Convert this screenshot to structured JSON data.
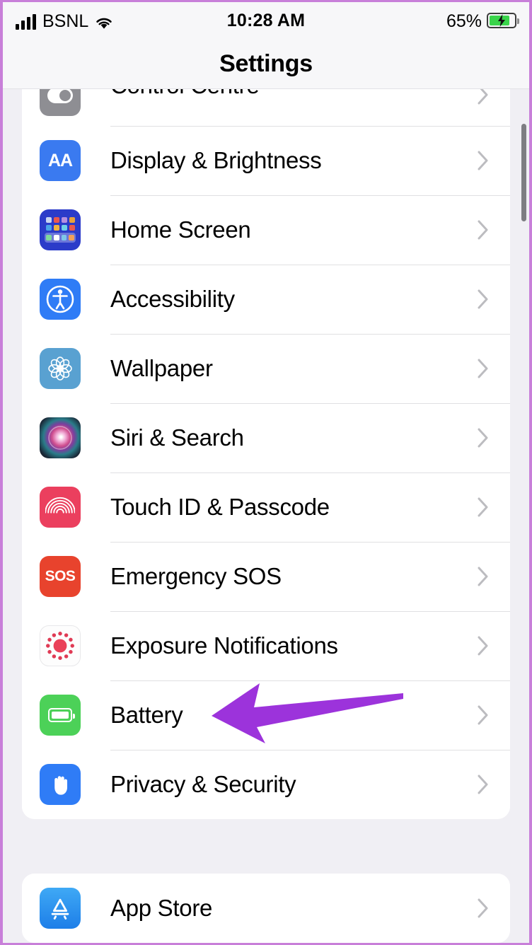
{
  "status_bar": {
    "carrier": "BSNL",
    "signal_icon": "cellular-bars-icon",
    "wifi_icon": "wifi-icon",
    "time": "10:28 AM",
    "battery_percent": "65%",
    "battery_icon": "battery-charging-icon",
    "battery_level": 65,
    "charging": true
  },
  "nav": {
    "title": "Settings"
  },
  "colors": {
    "page_background": "#f0eff4",
    "card_background": "#ffffff",
    "separator": "#e0e0e2",
    "chevron": "#bcbcc0",
    "arrow_annotation": "#9c33db",
    "frame_border": "#c87fd9",
    "battery_green": "#4cd158",
    "scrollbar": "#7d7d82"
  },
  "sections": [
    {
      "name": "settings-group-primary",
      "clipped_top": true,
      "rows": [
        {
          "label": "Control Centre",
          "icon": "control-centre-icon",
          "icon_style": "ic-cc",
          "partial": true,
          "chevron": true
        },
        {
          "label": "Display & Brightness",
          "icon": "display-brightness-icon",
          "icon_style": "ic-display",
          "partial": false,
          "chevron": true
        },
        {
          "label": "Home Screen",
          "icon": "home-screen-icon",
          "icon_style": "ic-home",
          "partial": false,
          "chevron": true
        },
        {
          "label": "Accessibility",
          "icon": "accessibility-icon",
          "icon_style": "ic-access",
          "partial": false,
          "chevron": true
        },
        {
          "label": "Wallpaper",
          "icon": "wallpaper-icon",
          "icon_style": "ic-wall",
          "partial": false,
          "chevron": true
        },
        {
          "label": "Siri & Search",
          "icon": "siri-search-icon",
          "icon_style": "ic-siri",
          "partial": false,
          "chevron": true
        },
        {
          "label": "Touch ID & Passcode",
          "icon": "touch-id-icon",
          "icon_style": "ic-touch",
          "partial": false,
          "chevron": true
        },
        {
          "label": "Emergency SOS",
          "icon": "emergency-sos-icon",
          "icon_style": "ic-sos",
          "partial": false,
          "chevron": true
        },
        {
          "label": "Exposure Notifications",
          "icon": "exposure-notifications-icon",
          "icon_style": "ic-expo",
          "partial": false,
          "chevron": true
        },
        {
          "label": "Battery",
          "icon": "battery-icon",
          "icon_style": "ic-batt",
          "partial": false,
          "chevron": true
        },
        {
          "label": "Privacy & Security",
          "icon": "privacy-security-icon",
          "icon_style": "ic-priv",
          "partial": false,
          "chevron": true
        }
      ]
    },
    {
      "name": "settings-group-store",
      "clipped_top": false,
      "rows": [
        {
          "label": "App Store",
          "icon": "app-store-icon",
          "icon_style": "ic-appstore",
          "partial": false,
          "chevron": true
        }
      ]
    }
  ],
  "annotation": {
    "type": "arrow",
    "points_at": "Battery",
    "direction": "left",
    "color": "#9c33db"
  },
  "icon_glyphs": {
    "display_brightness_text": "AA",
    "emergency_sos_text": "SOS"
  }
}
